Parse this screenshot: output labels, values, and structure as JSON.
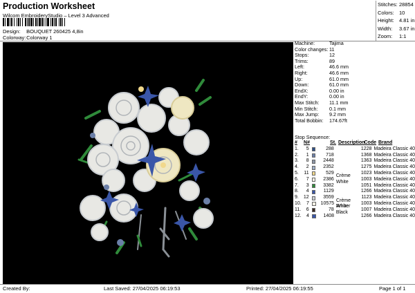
{
  "header": {
    "title": "Production Worksheet",
    "subtitle": "Wilcom EmbroideryStudio – Level 3 Advanced",
    "design_label": "Design:",
    "design_value": "BOUQUET 260425 4,8in",
    "colorway_label": "Colorway:",
    "colorway_value": "Colorway 1"
  },
  "summary": [
    {
      "label": "Stitches:",
      "value": "28854"
    },
    {
      "label": "Colors:",
      "value": "10"
    },
    {
      "label": "Height:",
      "value": "4.81 in"
    },
    {
      "label": "Width:",
      "value": "3.67 in"
    },
    {
      "label": "Zoom:",
      "value": "1:1"
    }
  ],
  "machine_info": [
    {
      "label": "Machine:",
      "value": "Tajima"
    },
    {
      "label": "Color changes:",
      "value": "11"
    },
    {
      "label": "Stops:",
      "value": "12"
    },
    {
      "label": "Trims:",
      "value": "89"
    },
    {
      "label": "Left:",
      "value": "46.6 mm"
    },
    {
      "label": "Right:",
      "value": "46.6 mm"
    },
    {
      "label": "Up:",
      "value": "61.0 mm"
    },
    {
      "label": "Down:",
      "value": "61.0 mm"
    },
    {
      "label": "EndX:",
      "value": "0.00 in"
    },
    {
      "label": "EndY:",
      "value": "0.00 in"
    },
    {
      "label": "Max Stitch:",
      "value": "11.1 mm"
    },
    {
      "label": "Min Stitch:",
      "value": "0.1 mm"
    },
    {
      "label": "Max Jump:",
      "value": "9.2 mm"
    },
    {
      "label": "Total Bobbin:",
      "value": "174.67ft"
    }
  ],
  "stop_sequence": {
    "title": "Stop Sequence:",
    "headers": [
      "#",
      "N#",
      "St.",
      "Description",
      "Code",
      "Brand"
    ],
    "rows": [
      {
        "n": "1.",
        "nn": "5",
        "color": "#2e4f86",
        "st": "288",
        "desc": "",
        "code": "1228",
        "brand": "Madeira Classic 40"
      },
      {
        "n": "2.",
        "nn": "1",
        "color": "#6b7fa8",
        "st": "718",
        "desc": "",
        "code": "1368",
        "brand": "Madeira Classic 40"
      },
      {
        "n": "3.",
        "nn": "8",
        "color": "#8c96a6",
        "st": "2448",
        "desc": "",
        "code": "1363",
        "brand": "Madeira Classic 40"
      },
      {
        "n": "4.",
        "nn": "2",
        "color": "#9fb0c8",
        "st": "2352",
        "desc": "",
        "code": "1275",
        "brand": "Madeira Classic 40"
      },
      {
        "n": "5.",
        "nn": "11",
        "color": "#f1d88c",
        "st": "529",
        "desc": "",
        "code": "1023",
        "brand": "Madeira Classic 40"
      },
      {
        "n": "6.",
        "nn": "7",
        "color": "#f3f0e4",
        "st": "2386",
        "desc": "Crème White",
        "code": "1003",
        "brand": "Madeira Classic 40"
      },
      {
        "n": "7.",
        "nn": "3",
        "color": "#2f8a3a",
        "st": "3382",
        "desc": "",
        "code": "1051",
        "brand": "Madeira Classic 40"
      },
      {
        "n": "8.",
        "nn": "4",
        "color": "#3a56a8",
        "st": "1129",
        "desc": "",
        "code": "1266",
        "brand": "Madeira Classic 40"
      },
      {
        "n": "9.",
        "nn": "12",
        "color": "#c8ccd0",
        "st": "3559",
        "desc": "",
        "code": "1123",
        "brand": "Madeira Classic 40"
      },
      {
        "n": "10.",
        "nn": "7",
        "color": "#f3f0e4",
        "st": "10575",
        "desc": "Crème White",
        "code": "1003",
        "brand": "Madeira Classic 40"
      },
      {
        "n": "11.",
        "nn": "6",
        "color": "#3b2a22",
        "st": "78",
        "desc": "Amber Black",
        "code": "1007",
        "brand": "Madeira Classic 40"
      },
      {
        "n": "12.",
        "nn": "4",
        "color": "#3a56a8",
        "st": "1408",
        "desc": "",
        "code": "1266",
        "brand": "Madeira Classic 40"
      }
    ]
  },
  "footer": {
    "created": "Created By:",
    "last_saved": "Last Saved: 27/04/2025 06:19:53",
    "printed": "Printed: 27/04/2025 06:19:55",
    "page": "Page 1 of 1"
  }
}
